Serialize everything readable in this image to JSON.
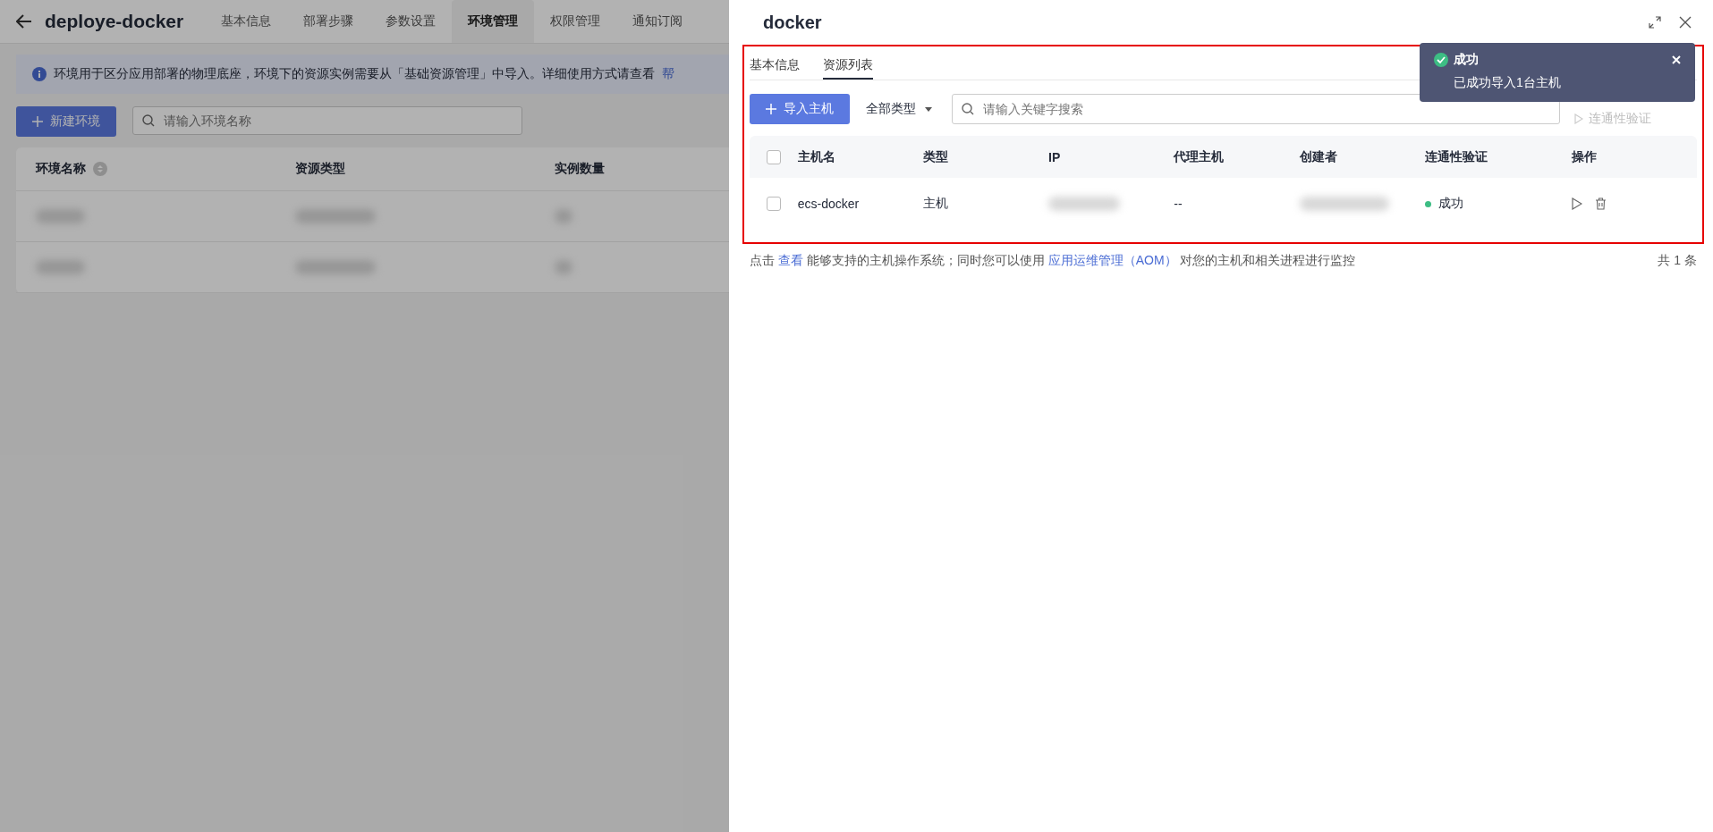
{
  "page": {
    "title": "deploye-docker",
    "tabs": [
      {
        "label": "基本信息",
        "selected": false
      },
      {
        "label": "部署步骤",
        "selected": false
      },
      {
        "label": "参数设置",
        "selected": false
      },
      {
        "label": "环境管理",
        "selected": true
      },
      {
        "label": "权限管理",
        "selected": false
      },
      {
        "label": "通知订阅",
        "selected": false
      }
    ],
    "banner": {
      "text": "环境用于区分应用部署的物理底座，环境下的资源实例需要从「基础资源管理」中导入。详细使用方式请查看",
      "link": "帮"
    },
    "new_button": "新建环境",
    "search": {
      "placeholder": "请输入环境名称"
    },
    "table": {
      "columns": [
        {
          "label": "环境名称",
          "sortable": true
        },
        {
          "label": "资源类型",
          "sortable": false
        },
        {
          "label": "实例数量",
          "sortable": false
        }
      ],
      "rows": [
        {
          "kind": "redacted"
        },
        {
          "kind": "redacted"
        }
      ]
    }
  },
  "drawer": {
    "title": "docker",
    "tabs": [
      {
        "label": "基本信息",
        "selected": false
      },
      {
        "label": "资源列表",
        "selected": true
      }
    ],
    "import_button": "导入主机",
    "type_filter": "全部类型",
    "search": {
      "placeholder": "请输入关键字搜索"
    },
    "connectivity_button": "连通性验证",
    "table": {
      "columns": [
        "主机名",
        "类型",
        "IP",
        "代理主机",
        "创建者",
        "连通性验证",
        "操作"
      ],
      "rows": [
        {
          "checked": false,
          "name": "ecs-docker",
          "type": "主机",
          "proxy": "--",
          "status": "成功",
          "color": "#3dbd84"
        }
      ],
      "select_all_checked": false
    },
    "footer": {
      "prefix": "点击",
      "link1": "查看",
      "middle": "能够支持的主机操作系统；同时您可以使用",
      "link2": "应用运维管理（AOM）",
      "suffix": "对您的主机和相关进程进行监控",
      "total": "共 1 条"
    }
  },
  "toast": {
    "title": "成功",
    "message": "已成功导入1台主机"
  }
}
